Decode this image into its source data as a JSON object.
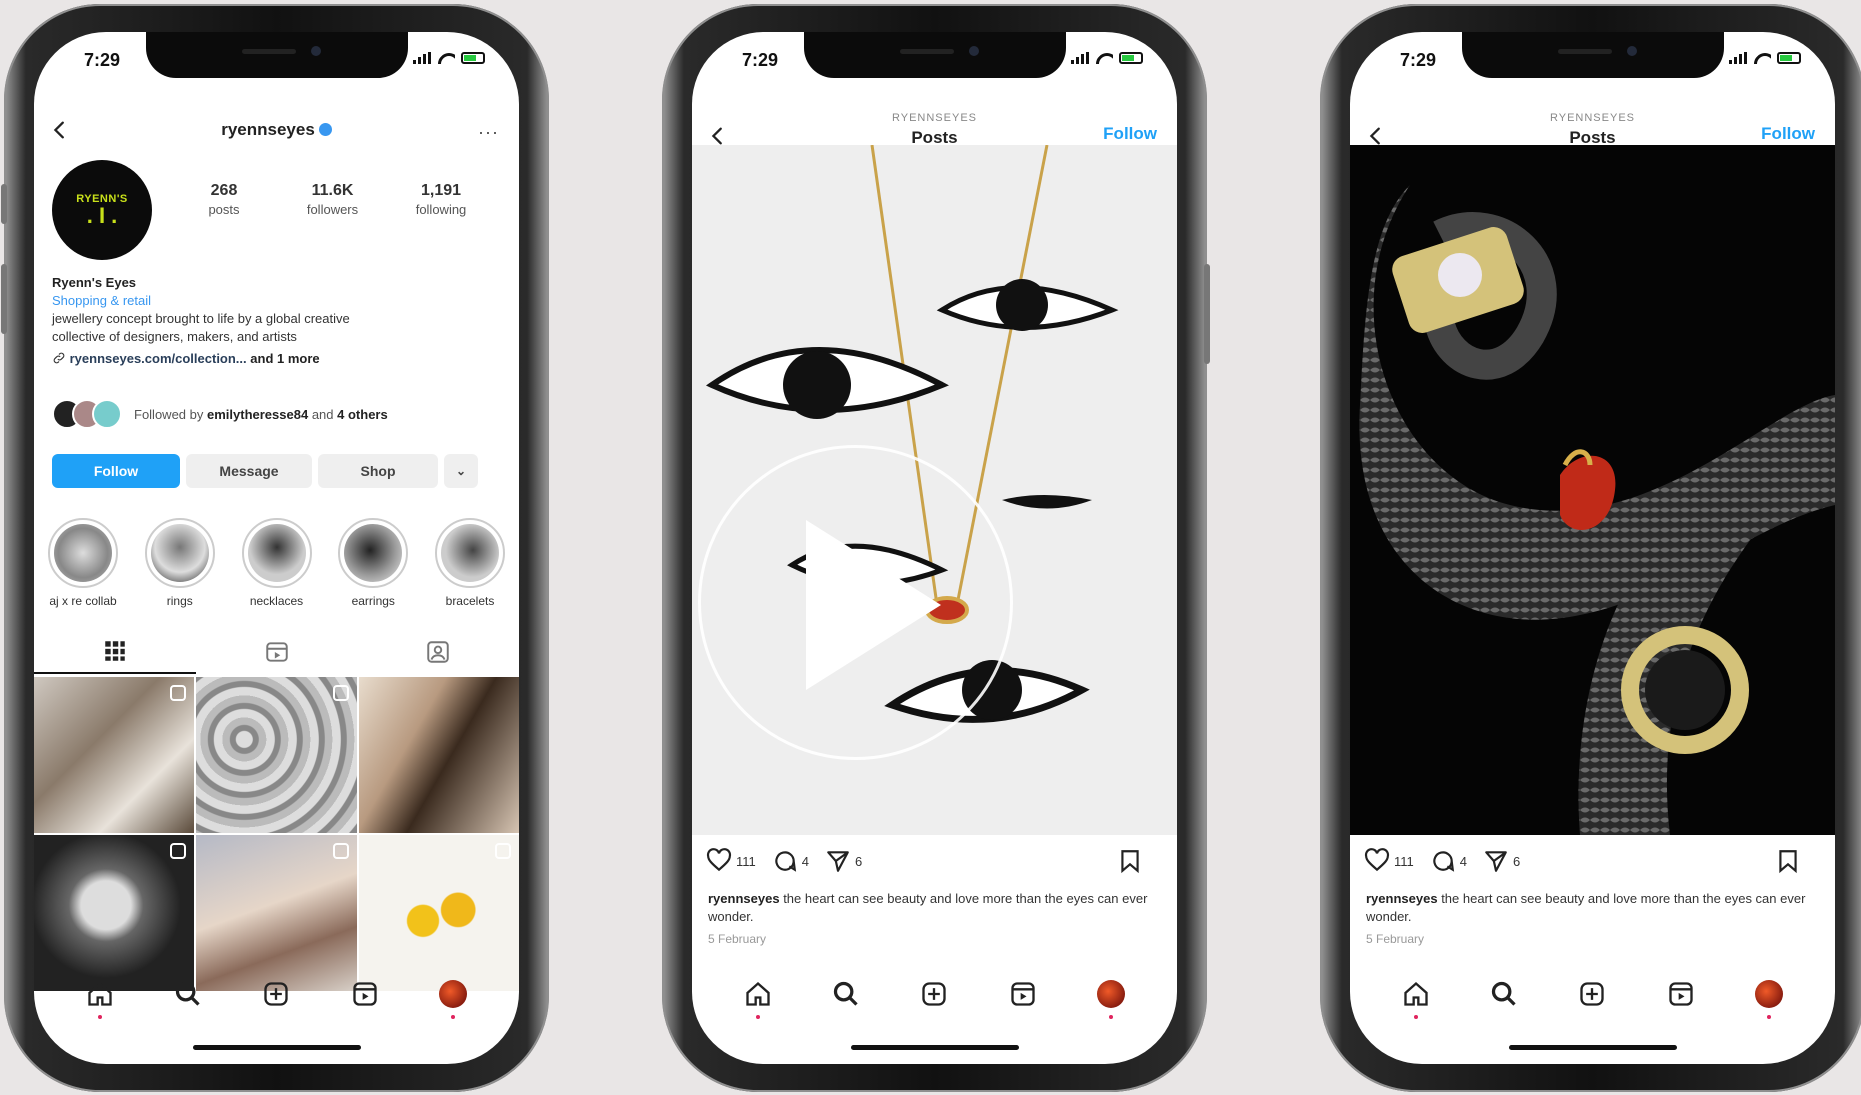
{
  "status": {
    "time": "7:29"
  },
  "profile": {
    "handle": "ryennseyes",
    "more_icon_label": "···",
    "logo": {
      "line1": "RYENN'S",
      "line2": ". I ."
    },
    "stats": [
      {
        "num": "268",
        "label": "posts"
      },
      {
        "num": "11.6K",
        "label": "followers"
      },
      {
        "num": "1,191",
        "label": "following"
      }
    ],
    "bio": {
      "name": "Ryenn's Eyes",
      "category": "Shopping & retail",
      "line1": "jewellery concept brought to life by a global creative",
      "line2": "collective of designers, makers, and artists",
      "link": "ryennseyes.com/collection...",
      "link_more": "and 1 more"
    },
    "followed": {
      "prefix": "Followed by",
      "user": "emilytheresse84",
      "and": "and",
      "others": "4 others"
    },
    "buttons": {
      "follow": "Follow",
      "message": "Message",
      "shop": "Shop",
      "chevron": "⌄"
    },
    "highlights": [
      {
        "label": "aj x re collab"
      },
      {
        "label": "rings"
      },
      {
        "label": "necklaces"
      },
      {
        "label": "earrings"
      },
      {
        "label": "bracelets"
      }
    ]
  },
  "post": {
    "account": "RYENNSEYES",
    "title": "Posts",
    "follow": "Follow",
    "likes": "111",
    "comments": "4",
    "shares": "6",
    "caption_user": "ryennseyes",
    "caption_text": "the heart can see beauty and love more than the eyes can ever wonder.",
    "date": "5 February"
  },
  "colors": {
    "accent": "#1fa1f7",
    "logo": "#c8e01a"
  }
}
